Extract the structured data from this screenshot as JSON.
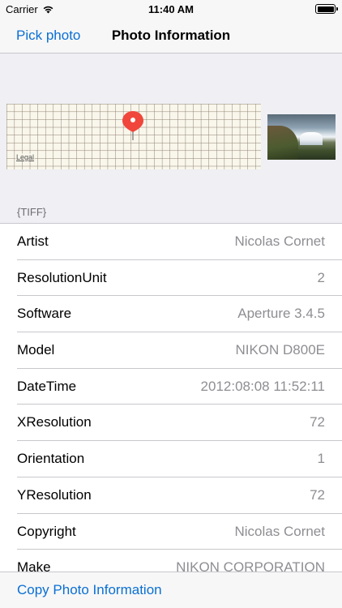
{
  "status_bar": {
    "carrier": "Carrier",
    "time": "11:40 AM"
  },
  "nav": {
    "left_button": "Pick photo",
    "title": "Photo Information"
  },
  "header": {
    "map_legal": "Legal",
    "pin_color": "#f0463c"
  },
  "section": {
    "title": "{TIFF}"
  },
  "rows": [
    {
      "label": "Artist",
      "value": "Nicolas Cornet"
    },
    {
      "label": "ResolutionUnit",
      "value": "2"
    },
    {
      "label": "Software",
      "value": "Aperture 3.4.5"
    },
    {
      "label": "Model",
      "value": "NIKON D800E"
    },
    {
      "label": "DateTime",
      "value": "2012:08:08 11:52:11"
    },
    {
      "label": "XResolution",
      "value": "72"
    },
    {
      "label": "Orientation",
      "value": "1"
    },
    {
      "label": "YResolution",
      "value": "72"
    },
    {
      "label": "Copyright",
      "value": "Nicolas Cornet"
    },
    {
      "label": "Make",
      "value": "NIKON CORPORATION"
    }
  ],
  "toolbar": {
    "copy_label": "Copy Photo Information"
  },
  "colors": {
    "accent": "#0a6fd4",
    "secondary_text": "#8e8e93",
    "background": "#efeff4"
  }
}
